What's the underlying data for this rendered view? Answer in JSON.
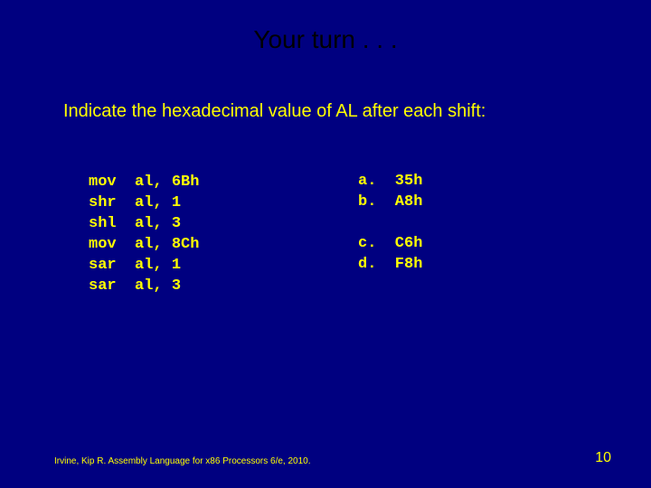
{
  "title": "Your turn . . .",
  "prompt": "Indicate the hexadecimal value of AL after each shift:",
  "code_lines": [
    "mov  al, 6Bh",
    "shr  al, 1",
    "shl  al, 3",
    "mov  al, 8Ch",
    "sar  al, 1",
    "sar  al, 3"
  ],
  "answers_block": "a.  35h\nb.  A8h\n\nc.  C6h\nd.  F8h",
  "footer": "Irvine, Kip R. Assembly Language for x86 Processors 6/e, 2010.",
  "page_number": "10"
}
